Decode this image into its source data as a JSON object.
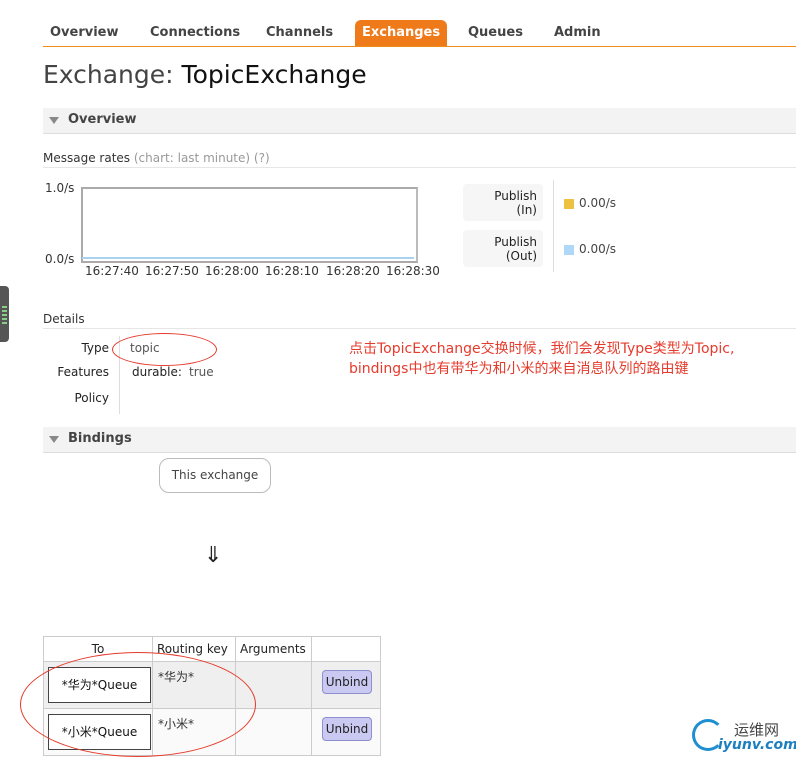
{
  "nav": {
    "items": [
      "Overview",
      "Connections",
      "Channels",
      "Exchanges",
      "Queues",
      "Admin"
    ],
    "active": "Exchanges"
  },
  "page": {
    "title_prefix": "Exchange:",
    "exchange_name": "TopicExchange"
  },
  "overview": {
    "section_label": "Overview",
    "message_rates_label": "Message rates",
    "chart_hint": "(chart: last minute)",
    "help_link": "(?)",
    "y_axis": [
      "1.0/s",
      "0.0/s"
    ],
    "x_ticks": [
      "16:27:40",
      "16:27:50",
      "16:28:00",
      "16:28:10",
      "16:28:20",
      "16:28:30"
    ],
    "rates": [
      {
        "label_line1": "Publish",
        "label_line2": "(In)",
        "value": "0.00/s",
        "color": "#edc240"
      },
      {
        "label_line1": "Publish",
        "label_line2": "(Out)",
        "value": "0.00/s",
        "color": "#afd8f8"
      }
    ]
  },
  "details": {
    "heading": "Details",
    "type_label": "Type",
    "type_value": "topic",
    "features_label": "Features",
    "features_key": "durable:",
    "features_value": "true",
    "policy_label": "Policy",
    "policy_value": ""
  },
  "annotation": {
    "line1": "点击TopicExchange交换时候，我们会发现Type类型为Topic,",
    "line2": "bindings中也有带华为和小米的来自消息队列的路由键",
    "color": "#e53b2c"
  },
  "bindings": {
    "section_label": "Bindings",
    "this_exchange": "This exchange",
    "arrow": "⇓",
    "columns": [
      "To",
      "Routing key",
      "Arguments",
      ""
    ],
    "rows": [
      {
        "to": "*华为*Queue",
        "routing_key": "*华为*",
        "arguments": "",
        "action": "Unbind"
      },
      {
        "to": "*小米*Queue",
        "routing_key": "*小米*",
        "arguments": "",
        "action": "Unbind"
      }
    ]
  },
  "watermark": {
    "cn": "运维网",
    "en": "iyunv.com"
  }
}
